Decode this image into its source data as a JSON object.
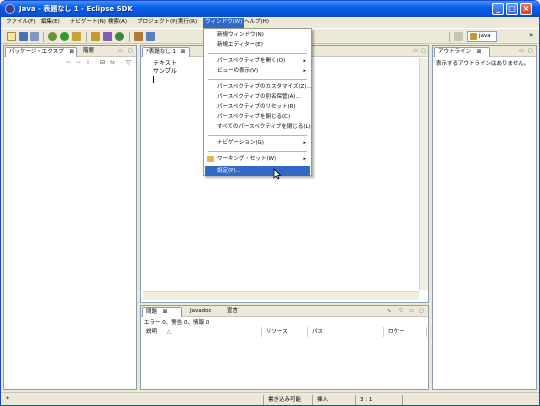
{
  "window": {
    "title": "Java - 表題なし 1 - Eclipse SDK",
    "controls": {
      "minimize": "_",
      "maximize": "□",
      "close": "×"
    }
  },
  "menubar": {
    "items": [
      "ファイル(F)",
      "編集(E)",
      "ナビゲート(N)",
      "検索(A)",
      "プロジェクト(P)",
      "実行(R)",
      "ウィンドウ(W)",
      "ヘルプ(H)"
    ]
  },
  "toolbar": {
    "perspective_label": "Java",
    "overflow": "»"
  },
  "left_panel": {
    "tab_package": "パッケージ・エクスプ",
    "tab_package_close": "⊠",
    "tab_hierarchy": "階層"
  },
  "editor": {
    "tab_label": "*表題なし 1",
    "tab_close": "⊠",
    "lines": [
      "テキスト",
      "サンプル"
    ]
  },
  "outline": {
    "tab_label": "アウトライン",
    "tab_close": "⊠",
    "message": "表示するアウトラインはありません。"
  },
  "bottom_panel": {
    "tabs": {
      "problems": "問題",
      "problems_close": "⊠",
      "javadoc": "Javadoc",
      "declaration": "宣言"
    },
    "summary": "エラー 0、警告 0、情報 0",
    "columns": [
      "説明",
      "リソース",
      "パス",
      "ロケー"
    ]
  },
  "window_menu": {
    "items": [
      {
        "label": "新規ウィンドウ(N)",
        "submenu": false
      },
      {
        "label": "新規エディター(E)",
        "submenu": false
      },
      {
        "sep": true
      },
      {
        "label": "パースペクティブを開く(O)",
        "submenu": true
      },
      {
        "label": "ビューの表示(V)",
        "submenu": true
      },
      {
        "sep": true
      },
      {
        "label": "パースペクティブのカスタマイズ(Z)...",
        "submenu": false
      },
      {
        "label": "パースペクティブの別名保管(A)...",
        "submenu": false
      },
      {
        "label": "パースペクティブのリセット(R)",
        "submenu": false
      },
      {
        "label": "パースペクティブを閉じる(C)",
        "submenu": false
      },
      {
        "label": "すべてのパースペクティブを閉じる(L)",
        "submenu": false
      },
      {
        "sep": true
      },
      {
        "label": "ナビゲーション(G)",
        "submenu": true
      },
      {
        "sep": true
      },
      {
        "label": "ワーキング・セット(W)",
        "submenu": true
      },
      {
        "sep": true
      },
      {
        "label": "設定(P)...",
        "submenu": false,
        "highlighted": true
      }
    ]
  },
  "statusbar": {
    "writable": "書き込み可能",
    "insert_mode": "挿入",
    "position": "3 : 1"
  },
  "colors": {
    "menu_highlight": "#316ac5",
    "titlebar": "#0554d6"
  }
}
